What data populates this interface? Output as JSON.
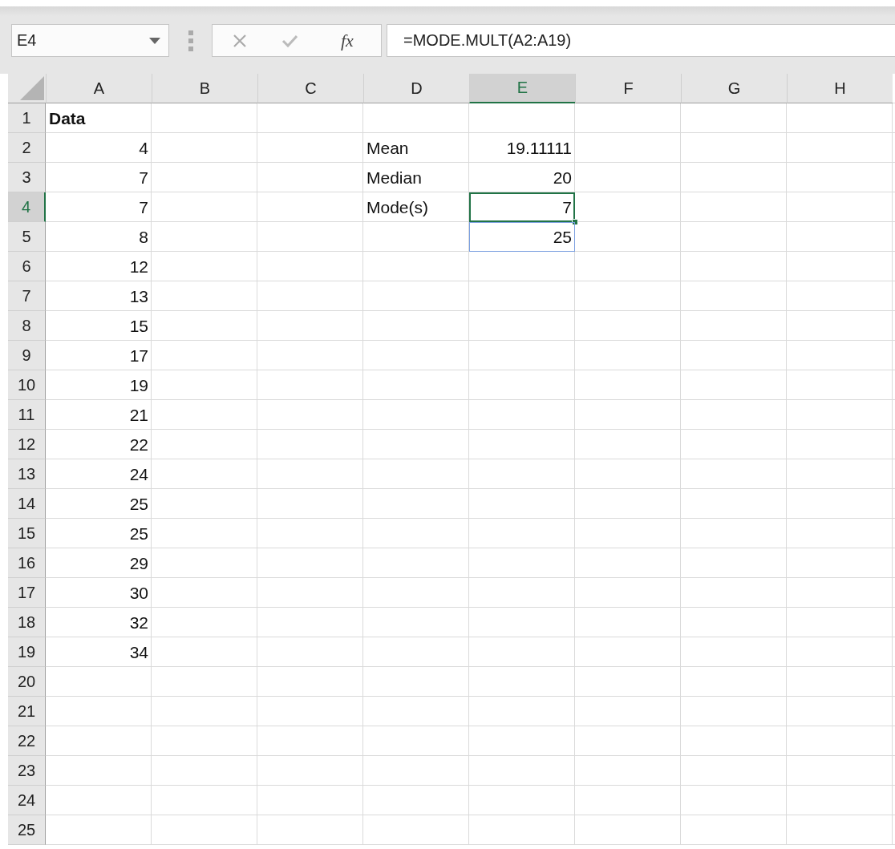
{
  "name_box": {
    "value": "E4"
  },
  "formula_bar": {
    "value": "=MODE.MULT(A2:A19)",
    "function_label": "fx"
  },
  "columns": [
    {
      "label": "A",
      "selected": false
    },
    {
      "label": "B",
      "selected": false
    },
    {
      "label": "C",
      "selected": false
    },
    {
      "label": "D",
      "selected": false
    },
    {
      "label": "E",
      "selected": true
    },
    {
      "label": "F",
      "selected": false
    },
    {
      "label": "G",
      "selected": false
    },
    {
      "label": "H",
      "selected": false
    }
  ],
  "rows": [
    {
      "label": "1",
      "selected": false,
      "cells": [
        {
          "value": "Data",
          "kind": "text",
          "bold": true,
          "selected": false,
          "spill": false
        },
        null,
        null,
        null,
        null,
        null,
        null,
        null
      ]
    },
    {
      "label": "2",
      "selected": false,
      "cells": [
        {
          "value": "4",
          "kind": "number",
          "bold": false,
          "selected": false,
          "spill": false
        },
        null,
        null,
        {
          "value": "Mean",
          "kind": "text",
          "bold": false,
          "selected": false,
          "spill": false
        },
        {
          "value": "19.11111",
          "kind": "number",
          "bold": false,
          "selected": false,
          "spill": false
        },
        null,
        null,
        null
      ]
    },
    {
      "label": "3",
      "selected": false,
      "cells": [
        {
          "value": "7",
          "kind": "number",
          "bold": false,
          "selected": false,
          "spill": false
        },
        null,
        null,
        {
          "value": "Median",
          "kind": "text",
          "bold": false,
          "selected": false,
          "spill": false
        },
        {
          "value": "20",
          "kind": "number",
          "bold": false,
          "selected": false,
          "spill": false
        },
        null,
        null,
        null
      ]
    },
    {
      "label": "4",
      "selected": true,
      "cells": [
        {
          "value": "7",
          "kind": "number",
          "bold": false,
          "selected": false,
          "spill": false
        },
        null,
        null,
        {
          "value": "Mode(s)",
          "kind": "text",
          "bold": false,
          "selected": false,
          "spill": false
        },
        {
          "value": "7",
          "kind": "number",
          "bold": false,
          "selected": true,
          "spill": true
        },
        null,
        null,
        null
      ]
    },
    {
      "label": "5",
      "selected": false,
      "cells": [
        {
          "value": "8",
          "kind": "number",
          "bold": false,
          "selected": false,
          "spill": false
        },
        null,
        null,
        null,
        {
          "value": "25",
          "kind": "number",
          "bold": false,
          "selected": false,
          "spill": true
        },
        null,
        null,
        null
      ]
    },
    {
      "label": "6",
      "selected": false,
      "cells": [
        {
          "value": "12",
          "kind": "number",
          "bold": false,
          "selected": false,
          "spill": false
        },
        null,
        null,
        null,
        null,
        null,
        null,
        null
      ]
    },
    {
      "label": "7",
      "selected": false,
      "cells": [
        {
          "value": "13",
          "kind": "number",
          "bold": false,
          "selected": false,
          "spill": false
        },
        null,
        null,
        null,
        null,
        null,
        null,
        null
      ]
    },
    {
      "label": "8",
      "selected": false,
      "cells": [
        {
          "value": "15",
          "kind": "number",
          "bold": false,
          "selected": false,
          "spill": false
        },
        null,
        null,
        null,
        null,
        null,
        null,
        null
      ]
    },
    {
      "label": "9",
      "selected": false,
      "cells": [
        {
          "value": "17",
          "kind": "number",
          "bold": false,
          "selected": false,
          "spill": false
        },
        null,
        null,
        null,
        null,
        null,
        null,
        null
      ]
    },
    {
      "label": "10",
      "selected": false,
      "cells": [
        {
          "value": "19",
          "kind": "number",
          "bold": false,
          "selected": false,
          "spill": false
        },
        null,
        null,
        null,
        null,
        null,
        null,
        null
      ]
    },
    {
      "label": "11",
      "selected": false,
      "cells": [
        {
          "value": "21",
          "kind": "number",
          "bold": false,
          "selected": false,
          "spill": false
        },
        null,
        null,
        null,
        null,
        null,
        null,
        null
      ]
    },
    {
      "label": "12",
      "selected": false,
      "cells": [
        {
          "value": "22",
          "kind": "number",
          "bold": false,
          "selected": false,
          "spill": false
        },
        null,
        null,
        null,
        null,
        null,
        null,
        null
      ]
    },
    {
      "label": "13",
      "selected": false,
      "cells": [
        {
          "value": "24",
          "kind": "number",
          "bold": false,
          "selected": false,
          "spill": false
        },
        null,
        null,
        null,
        null,
        null,
        null,
        null
      ]
    },
    {
      "label": "14",
      "selected": false,
      "cells": [
        {
          "value": "25",
          "kind": "number",
          "bold": false,
          "selected": false,
          "spill": false
        },
        null,
        null,
        null,
        null,
        null,
        null,
        null
      ]
    },
    {
      "label": "15",
      "selected": false,
      "cells": [
        {
          "value": "25",
          "kind": "number",
          "bold": false,
          "selected": false,
          "spill": false
        },
        null,
        null,
        null,
        null,
        null,
        null,
        null
      ]
    },
    {
      "label": "16",
      "selected": false,
      "cells": [
        {
          "value": "29",
          "kind": "number",
          "bold": false,
          "selected": false,
          "spill": false
        },
        null,
        null,
        null,
        null,
        null,
        null,
        null
      ]
    },
    {
      "label": "17",
      "selected": false,
      "cells": [
        {
          "value": "30",
          "kind": "number",
          "bold": false,
          "selected": false,
          "spill": false
        },
        null,
        null,
        null,
        null,
        null,
        null,
        null
      ]
    },
    {
      "label": "18",
      "selected": false,
      "cells": [
        {
          "value": "32",
          "kind": "number",
          "bold": false,
          "selected": false,
          "spill": false
        },
        null,
        null,
        null,
        null,
        null,
        null,
        null
      ]
    },
    {
      "label": "19",
      "selected": false,
      "cells": [
        {
          "value": "34",
          "kind": "number",
          "bold": false,
          "selected": false,
          "spill": false
        },
        null,
        null,
        null,
        null,
        null,
        null,
        null
      ]
    },
    {
      "label": "20",
      "selected": false
    },
    {
      "label": "21",
      "selected": false
    },
    {
      "label": "22",
      "selected": false
    },
    {
      "label": "23",
      "selected": false
    },
    {
      "label": "24",
      "selected": false
    },
    {
      "label": "25",
      "selected": false
    }
  ]
}
